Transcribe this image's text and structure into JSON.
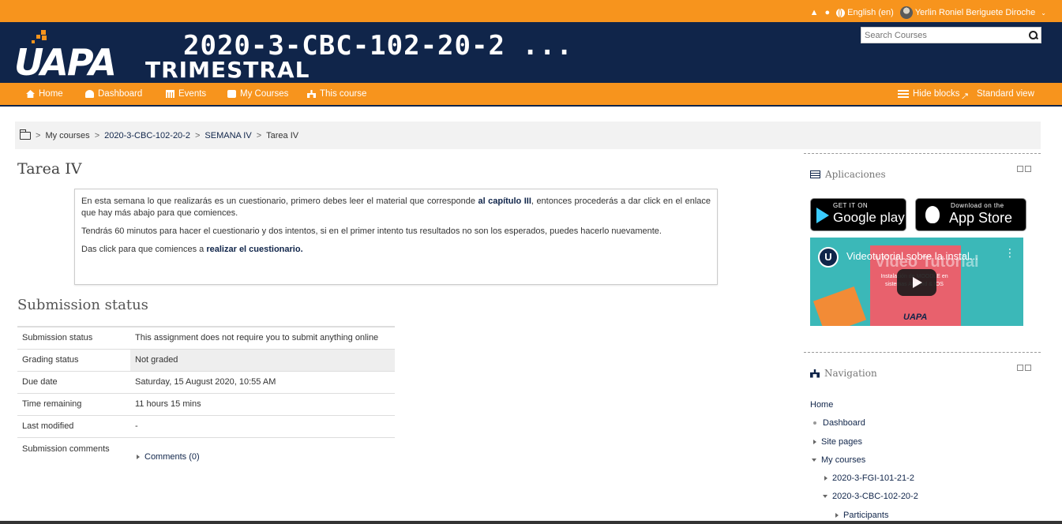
{
  "topbar": {
    "language": "English (en)",
    "user_name": "Yerlin Roniel Beriguete Diroche"
  },
  "header": {
    "logo_text": "UAPA",
    "course_title": "2020-3-CBC-102-20-2 ...",
    "course_subtitle": "TRIMESTRAL",
    "search_placeholder": "Search Courses"
  },
  "nav": {
    "home": "Home",
    "dashboard": "Dashboard",
    "events": "Events",
    "my_courses": "My Courses",
    "this_course": "This course",
    "hide_blocks": "Hide blocks",
    "standard_view": "Standard view"
  },
  "breadcrumb": {
    "items": [
      "My courses",
      "2020-3-CBC-102-20-2",
      "SEMANA IV",
      "Tarea IV"
    ],
    "separator": ">"
  },
  "page": {
    "title": "Tarea IV",
    "intro_p1_a": "En esta semana lo que realizarás es un cuestionario, primero debes leer el material que corresponde ",
    "intro_p1_bold": "al capítulo III",
    "intro_p1_b": ", entonces procederás a dar click en el enlace que hay más abajo para que comiences.",
    "intro_p2": "Tendrás 60 minutos para hacer el cuestionario  y dos intentos, si en el primer intento tus resultados no son los esperados, puedes hacerlo nuevamente.",
    "intro_p3_a": "Das click para que comiences a ",
    "intro_p3_link": "realizar el cuestionario."
  },
  "submission": {
    "title": "Submission status",
    "rows": [
      {
        "label": "Submission status",
        "value": "This assignment does not require you to submit anything online"
      },
      {
        "label": "Grading status",
        "value": "Not graded"
      },
      {
        "label": "Due date",
        "value": "Saturday, 15 August 2020, 10:55 AM"
      },
      {
        "label": "Time remaining",
        "value": "11 hours 15 mins"
      },
      {
        "label": "Last modified",
        "value": "-"
      },
      {
        "label": "Submission comments",
        "value": "Comments (0)"
      }
    ]
  },
  "blocks": {
    "apps_title": "Aplicaciones",
    "google_small": "GET IT ON",
    "google_big": "Google play",
    "apple_small": "Download on the",
    "apple_big": "App Store",
    "video_title": "Videotutorial sobre la instal...",
    "video_overlay_big": "Video Tutorial",
    "video_overlay_text": "Instalación de MOODLE en sistemas Android & IOS",
    "video_logo": "UAPA",
    "nav_title": "Navigation",
    "nav_items": [
      "Home",
      "Dashboard",
      "Site pages",
      "My courses",
      "2020-3-FGI-101-21-2",
      "2020-3-CBC-102-20-2",
      "Participants"
    ]
  },
  "colors": {
    "brand_orange": "#f7941d",
    "brand_navy": "#10254a"
  }
}
